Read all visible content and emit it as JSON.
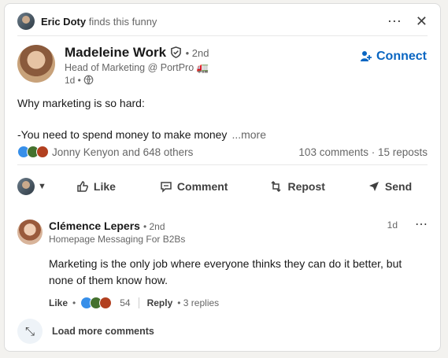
{
  "activity": {
    "actor": "Eric Doty",
    "action": "finds this funny",
    "more_icon": "ellipsis",
    "close_icon": "close"
  },
  "author": {
    "name": "Madeleine Work",
    "verified_icon": "shield-check",
    "degree": "• 2nd",
    "headline": "Head of Marketing @ PortPro 🚛",
    "time": "1d •",
    "visibility_icon": "globe"
  },
  "connect": {
    "label": "Connect",
    "icon": "add-person"
  },
  "post": {
    "line1": "Why marketing is so hard:",
    "line2": "-You need to spend money to make money",
    "more": "...more"
  },
  "social": {
    "reactions": [
      "like",
      "celebrate",
      "insightful"
    ],
    "reactors": "Jonny Kenyon and 648 others",
    "counts": "103 comments · 15 reposts"
  },
  "actions": {
    "like": "Like",
    "comment": "Comment",
    "repost": "Repost",
    "send": "Send"
  },
  "comment": {
    "name": "Clémence Lepers",
    "degree": "• 2nd",
    "headline": "Homepage Messaging For B2Bs",
    "time": "1d",
    "text": "Marketing is the only job where everyone thinks they can do it better, but none of them know how.",
    "like": "Like",
    "dot": "•",
    "reaction_count": "54",
    "reply": "Reply",
    "replies": "• 3 replies"
  },
  "load_more": "Load more comments",
  "colors": {
    "accent": "#0a66c2",
    "text": "#191919",
    "muted": "#666666"
  }
}
